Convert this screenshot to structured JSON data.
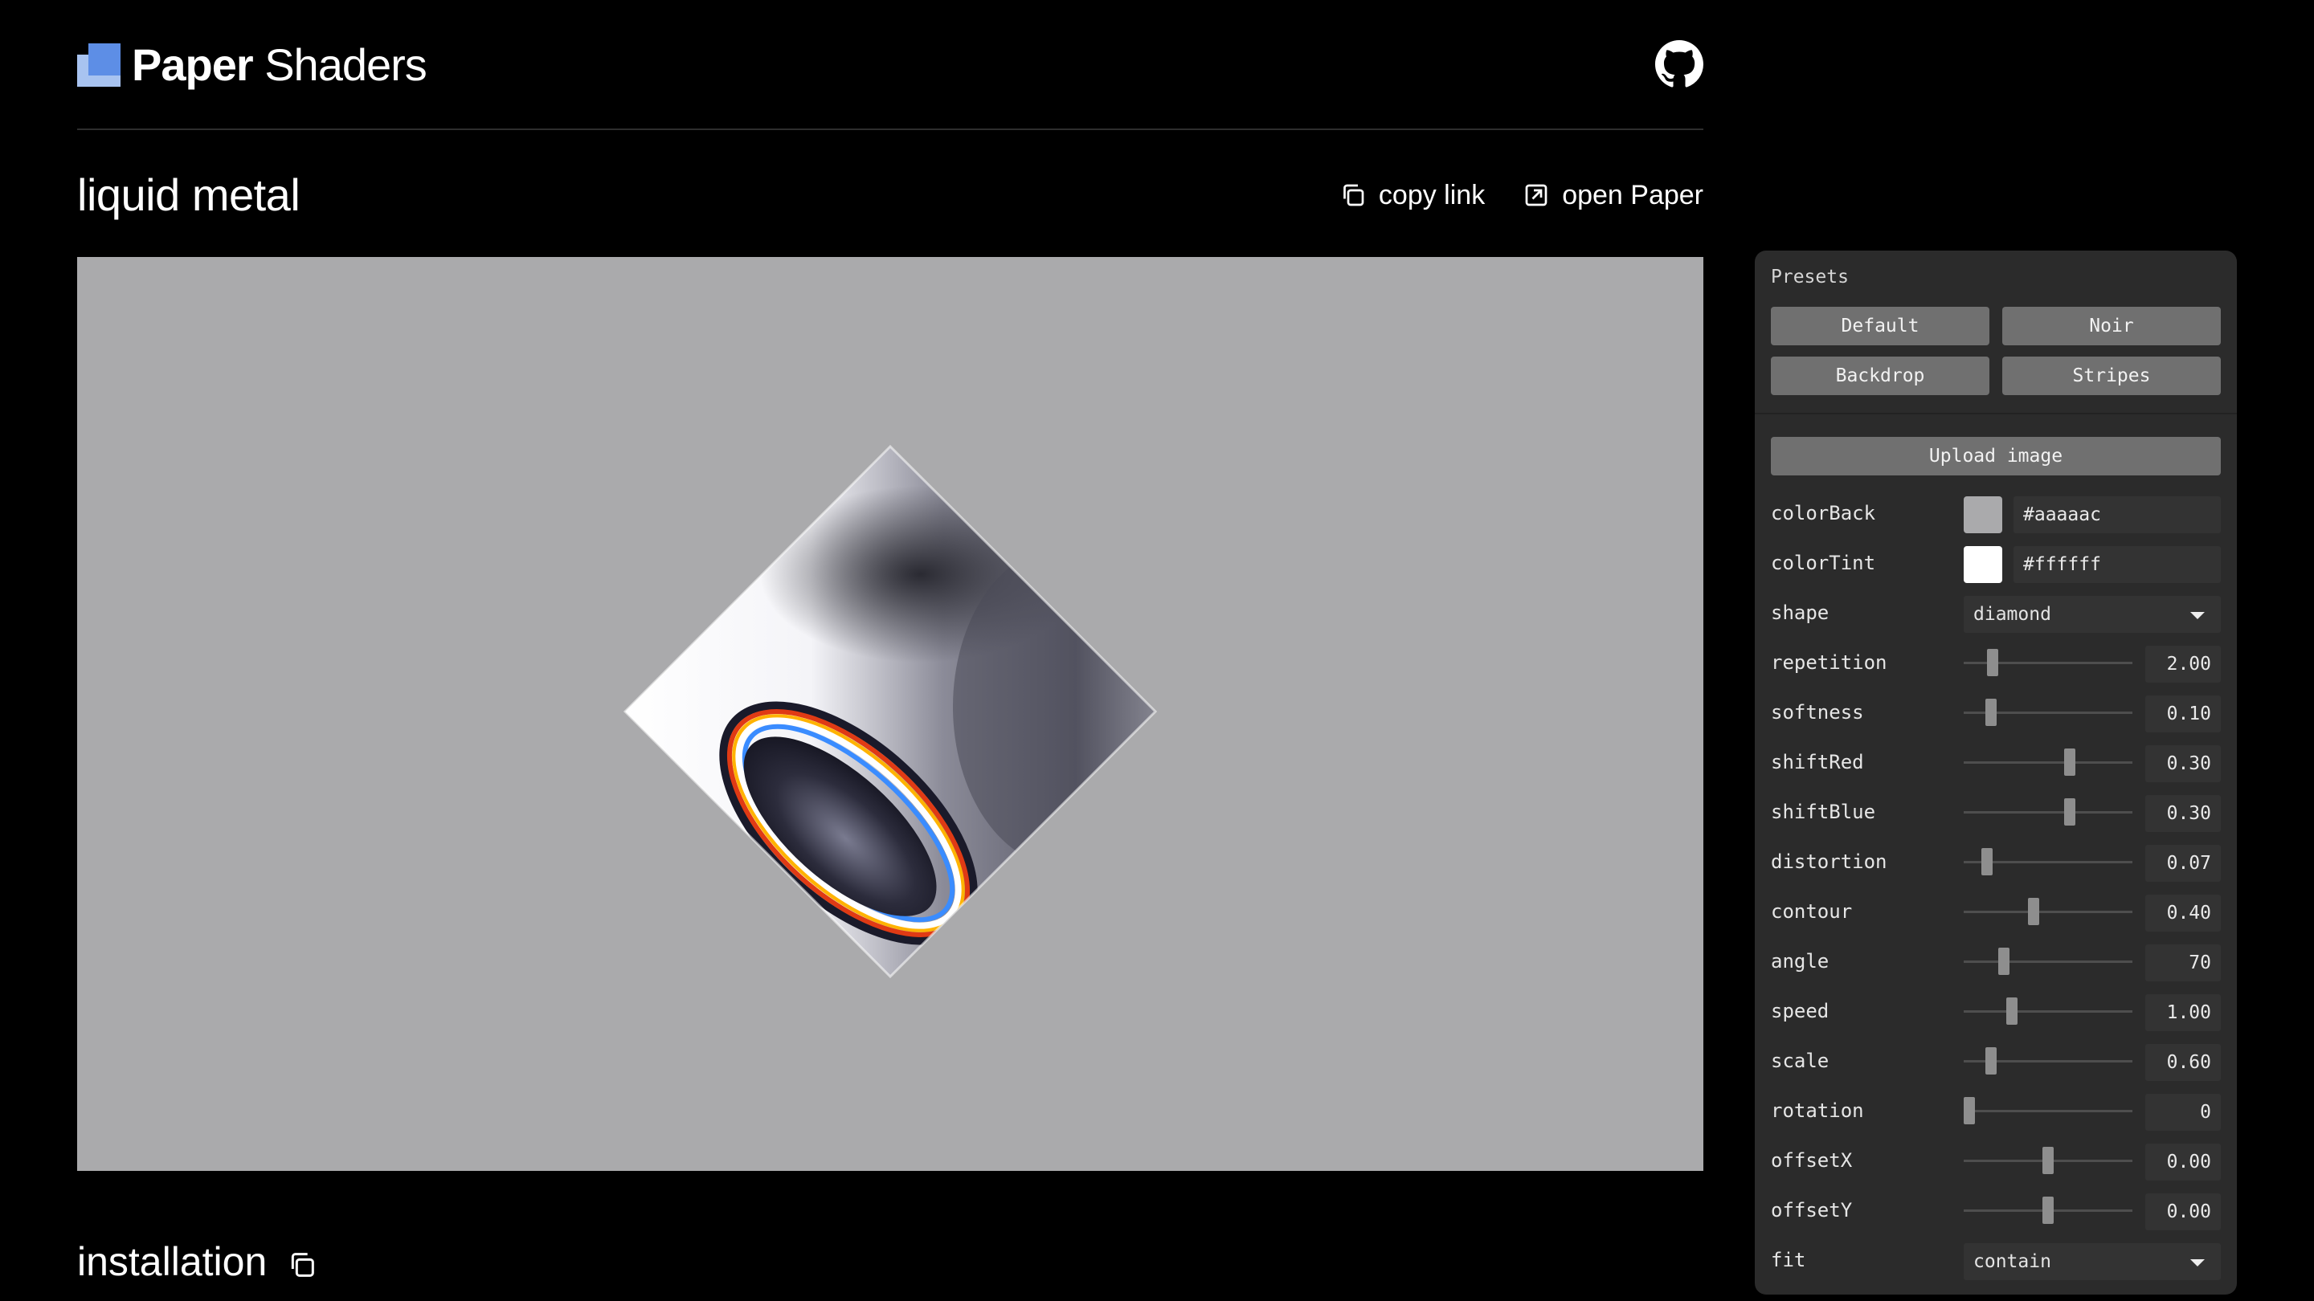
{
  "header": {
    "brand_strong": "Paper",
    "brand_light": "Shaders",
    "github_icon": "github-icon"
  },
  "page": {
    "title": "liquid metal",
    "copy_link_label": "copy link",
    "open_paper_label": "open Paper",
    "installation_label": "installation"
  },
  "canvas": {
    "background": "#aaaaac"
  },
  "panel": {
    "presets_title": "Presets",
    "presets": [
      "Default",
      "Noir",
      "Backdrop",
      "Stripes"
    ],
    "upload_label": "Upload image",
    "colors": [
      {
        "label": "colorBack",
        "value": "#aaaaac",
        "swatch": "#aaaaac"
      },
      {
        "label": "colorTint",
        "value": "#ffffff",
        "swatch": "#ffffff"
      }
    ],
    "shape": {
      "label": "shape",
      "value": "diamond"
    },
    "sliders": [
      {
        "label": "repetition",
        "value": "2.00",
        "fraction": 0.15
      },
      {
        "label": "softness",
        "value": "0.10",
        "fraction": 0.14
      },
      {
        "label": "shiftRed",
        "value": "0.30",
        "fraction": 0.64
      },
      {
        "label": "shiftBlue",
        "value": "0.30",
        "fraction": 0.64
      },
      {
        "label": "distortion",
        "value": "0.07",
        "fraction": 0.11
      },
      {
        "label": "contour",
        "value": "0.40",
        "fraction": 0.41
      },
      {
        "label": "angle",
        "value": "70",
        "fraction": 0.22
      },
      {
        "label": "speed",
        "value": "1.00",
        "fraction": 0.27
      },
      {
        "label": "scale",
        "value": "0.60",
        "fraction": 0.14
      },
      {
        "label": "rotation",
        "value": "0",
        "fraction": 0.0
      },
      {
        "label": "offsetX",
        "value": "0.00",
        "fraction": 0.5
      },
      {
        "label": "offsetY",
        "value": "0.00",
        "fraction": 0.5
      }
    ],
    "fit": {
      "label": "fit",
      "value": "contain"
    }
  }
}
